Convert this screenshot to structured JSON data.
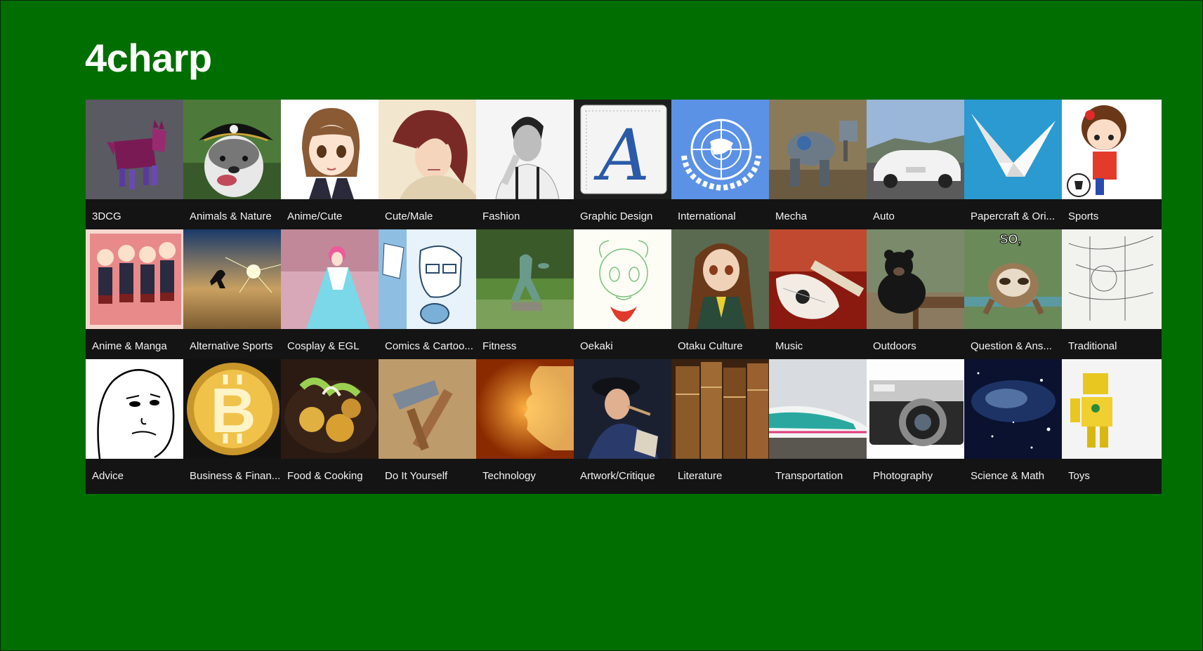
{
  "app": {
    "title": "4charp"
  },
  "rows": [
    [
      {
        "label": "3DCG",
        "icon": "3d-horse-icon"
      },
      {
        "label": "Animals & Nature",
        "icon": "pirate-dog-icon"
      },
      {
        "label": "Anime/Cute",
        "icon": "anime-girl-icon"
      },
      {
        "label": "Cute/Male",
        "icon": "anime-male-icon"
      },
      {
        "label": "Fashion",
        "icon": "fashion-man-icon"
      },
      {
        "label": "Graphic Design",
        "icon": "font-letter-a-icon"
      },
      {
        "label": "International",
        "icon": "un-emblem-icon"
      },
      {
        "label": "Mecha",
        "icon": "mecha-robot-icon"
      },
      {
        "label": "Auto",
        "icon": "convertible-car-icon"
      },
      {
        "label": "Papercraft & Ori...",
        "icon": "origami-crane-icon"
      },
      {
        "label": "Sports",
        "icon": "soccer-girl-icon"
      }
    ],
    [
      {
        "label": "Anime & Manga",
        "icon": "anime-group-icon"
      },
      {
        "label": "Alternative Sports",
        "icon": "sunset-jump-icon"
      },
      {
        "label": "Cosplay & EGL",
        "icon": "cosplay-dress-icon"
      },
      {
        "label": "Comics & Cartoo...",
        "icon": "comic-sketch-icon"
      },
      {
        "label": "Fitness",
        "icon": "discus-statue-icon"
      },
      {
        "label": "Oekaki",
        "icon": "oekaki-sketch-icon"
      },
      {
        "label": "Otaku Culture",
        "icon": "otaku-girl-icon"
      },
      {
        "label": "Music",
        "icon": "guitar-icon"
      },
      {
        "label": "Outdoors",
        "icon": "bear-icon"
      },
      {
        "label": "Question & Ans...",
        "icon": "sloth-so-icon",
        "caption": "SO,"
      },
      {
        "label": "Traditional",
        "icon": "map-sketch-icon"
      }
    ],
    [
      {
        "label": "Advice",
        "icon": "wojak-face-icon"
      },
      {
        "label": "Business & Finan...",
        "icon": "bitcoin-icon"
      },
      {
        "label": "Food & Cooking",
        "icon": "food-bowl-icon"
      },
      {
        "label": "Do It Yourself",
        "icon": "hammer-icon"
      },
      {
        "label": "Technology",
        "icon": "digital-face-icon"
      },
      {
        "label": "Artwork/Critique",
        "icon": "painting-icon"
      },
      {
        "label": "Literature",
        "icon": "old-books-icon"
      },
      {
        "label": "Transportation",
        "icon": "bullet-train-icon"
      },
      {
        "label": "Photography",
        "icon": "camera-icon"
      },
      {
        "label": "Science & Math",
        "icon": "galaxy-icon"
      },
      {
        "label": "Toys",
        "icon": "toy-robot-icon"
      }
    ]
  ],
  "colors": {
    "background": "#006e00",
    "tile": "#141414",
    "text": "#f2f2f2"
  }
}
